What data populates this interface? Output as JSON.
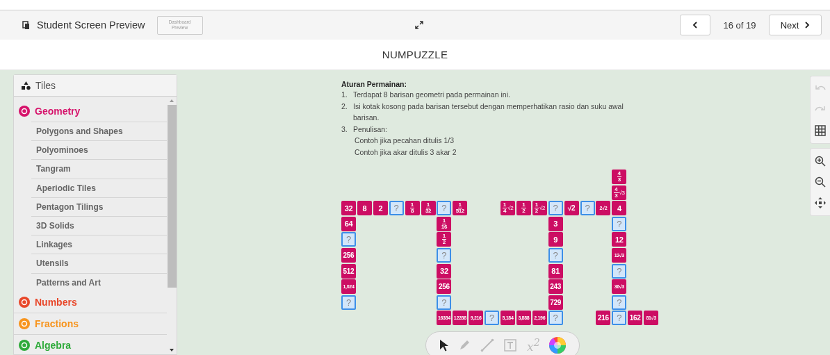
{
  "header": {
    "title": "Student Screen Preview",
    "dashboard_button": [
      "Dashboard",
      "Preview"
    ],
    "position": "16 of 19",
    "next_label": "Next"
  },
  "page_title": "NUMPUZZLE",
  "sidebar": {
    "title": "Tiles",
    "categories": [
      {
        "label": "Geometry",
        "color": "#d6136b",
        "expanded": true,
        "children": [
          {
            "label": "Polygons and Shapes"
          },
          {
            "label": "Polyominoes"
          },
          {
            "label": "Tangram"
          },
          {
            "label": "Aperiodic Tiles"
          },
          {
            "label": "Pentagon Tilings"
          },
          {
            "label": "3D Solids"
          },
          {
            "label": "Linkages"
          },
          {
            "label": "Utensils"
          },
          {
            "label": "Patterns and Art"
          }
        ]
      },
      {
        "label": "Numbers",
        "color": "#e8472a",
        "expanded": false
      },
      {
        "label": "Fractions",
        "color": "#f7941d",
        "expanded": false
      },
      {
        "label": "Algebra",
        "color": "#2eaa3a",
        "expanded": false
      }
    ]
  },
  "instructions": {
    "heading": "Aturan Permainan:",
    "items": [
      {
        "number": "1.",
        "text": "Terdapat 8 barisan geometri pada permainan ini."
      },
      {
        "number": "2.",
        "text": "Isi kotak kosong pada barisan tersebut dengan memperhatikan rasio dan suku awal barisan."
      },
      {
        "number": "3.",
        "text": "Penulisan:",
        "lines": [
          "Contoh jika pecahan ditulis 1/3",
          "Contoh jika akar ditulis 3 akar 2"
        ]
      }
    ]
  },
  "tiles": [
    {
      "kind": "fraction",
      "num": "4",
      "den": "3"
    },
    {
      "kind": "fraction",
      "num": "4",
      "den": "3",
      "root": "√3"
    },
    {
      "kind": "number",
      "text": "32"
    },
    {
      "kind": "number",
      "text": "8"
    },
    {
      "kind": "number",
      "text": "2"
    },
    {
      "kind": "blank",
      "text": "?"
    },
    {
      "kind": "fraction",
      "num": "1",
      "den": "8"
    },
    {
      "kind": "fraction",
      "num": "1",
      "den": "32"
    },
    {
      "kind": "blank",
      "text": "?"
    },
    {
      "kind": "fraction",
      "num": "1",
      "den": "512"
    },
    {
      "kind": "fraction",
      "num": "1",
      "den": "4",
      "root": "√2"
    },
    {
      "kind": "fraction",
      "num": "1",
      "den": "2"
    },
    {
      "kind": "fraction",
      "num": "1",
      "den": "2",
      "root": "√2"
    },
    {
      "kind": "blank",
      "text": "?"
    },
    {
      "kind": "number",
      "text": "√2"
    },
    {
      "kind": "blank",
      "text": "?"
    },
    {
      "kind": "number",
      "text": "2√2"
    },
    {
      "kind": "number",
      "text": "4"
    },
    {
      "kind": "number",
      "text": "64"
    },
    {
      "kind": "fraction",
      "num": "1",
      "den": "16"
    },
    {
      "kind": "number",
      "text": "3"
    },
    {
      "kind": "blank",
      "text": "?"
    },
    {
      "kind": "blank",
      "text": "?"
    },
    {
      "kind": "fraction",
      "num": "1",
      "den": "2"
    },
    {
      "kind": "number",
      "text": "9"
    },
    {
      "kind": "number",
      "text": "12"
    },
    {
      "kind": "number",
      "text": "256"
    },
    {
      "kind": "blank",
      "text": "?"
    },
    {
      "kind": "blank",
      "text": "?"
    },
    {
      "kind": "number",
      "text": "12√3"
    },
    {
      "kind": "number",
      "text": "512"
    },
    {
      "kind": "number",
      "text": "32"
    },
    {
      "kind": "number",
      "text": "81"
    },
    {
      "kind": "blank",
      "text": "?"
    },
    {
      "kind": "number",
      "text": "1,024"
    },
    {
      "kind": "number",
      "text": "256"
    },
    {
      "kind": "number",
      "text": "243"
    },
    {
      "kind": "number",
      "text": "36√3"
    },
    {
      "kind": "blank",
      "text": "?"
    },
    {
      "kind": "blank",
      "text": "?"
    },
    {
      "kind": "number",
      "text": "729"
    },
    {
      "kind": "blank",
      "text": "?"
    },
    {
      "kind": "number",
      "text": "16384"
    },
    {
      "kind": "number",
      "text": "12288"
    },
    {
      "kind": "number",
      "text": "9,216"
    },
    {
      "kind": "blank",
      "text": "?"
    },
    {
      "kind": "number",
      "text": "5,184"
    },
    {
      "kind": "number",
      "text": "3,888"
    },
    {
      "kind": "number",
      "text": "2,196"
    },
    {
      "kind": "blank",
      "text": "?"
    },
    {
      "kind": "number",
      "text": "216"
    },
    {
      "kind": "blank",
      "text": "?"
    },
    {
      "kind": "number",
      "text": "162"
    },
    {
      "kind": "number",
      "text": "81√3"
    }
  ],
  "side_tools": [
    {
      "kind": "undo",
      "disabled": true
    },
    {
      "kind": "redo",
      "disabled": true
    },
    {
      "kind": "grid",
      "disabled": false
    },
    {
      "kind": "zoom-in",
      "disabled": false
    },
    {
      "kind": "zoom-out",
      "disabled": false
    },
    {
      "kind": "move",
      "disabled": false
    }
  ],
  "tools": [
    {
      "kind": "pointer",
      "selected": true
    },
    {
      "kind": "pen",
      "selected": false
    },
    {
      "kind": "line",
      "selected": false
    },
    {
      "kind": "text",
      "selected": false
    },
    {
      "kind": "math",
      "label": "x$^{2}$",
      "selected": false
    },
    {
      "kind": "color"
    }
  ]
}
